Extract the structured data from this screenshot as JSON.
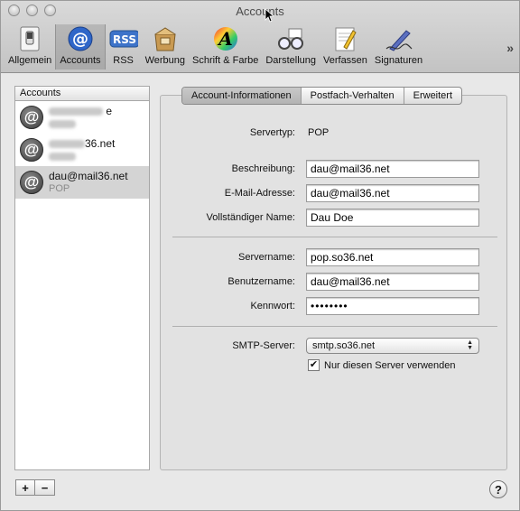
{
  "window": {
    "title": "Accounts"
  },
  "toolbar": {
    "items": [
      {
        "label": "Allgemein",
        "icon": "switch-icon"
      },
      {
        "label": "Accounts",
        "icon": "at-sign-icon"
      },
      {
        "label": "RSS",
        "icon": "rss-icon"
      },
      {
        "label": "Werbung",
        "icon": "junk-mail-icon"
      },
      {
        "label": "Schrift & Farbe",
        "icon": "font-color-icon"
      },
      {
        "label": "Darstellung",
        "icon": "viewing-glasses-icon"
      },
      {
        "label": "Verfassen",
        "icon": "compose-pencil-icon"
      },
      {
        "label": "Signaturen",
        "icon": "signature-pen-icon"
      }
    ],
    "overflow": "»"
  },
  "sidebar": {
    "header": "Accounts",
    "accounts": [
      {
        "name": "e",
        "sub": ""
      },
      {
        "name": "36.net",
        "sub": ""
      },
      {
        "name": "dau@mail36.net",
        "sub": "POP"
      }
    ],
    "add_label": "+",
    "remove_label": "−"
  },
  "tabs": [
    "Account-Informationen",
    "Postfach-Verhalten",
    "Erweitert"
  ],
  "form": {
    "servertyp_label": "Servertyp:",
    "servertyp_value": "POP",
    "beschreibung_label": "Beschreibung:",
    "beschreibung_value": "dau@mail36.net",
    "email_label": "E-Mail-Adresse:",
    "email_value": "dau@mail36.net",
    "name_label": "Vollständiger Name:",
    "name_value": "Dau Doe",
    "servername_label": "Servername:",
    "servername_value": "pop.so36.net",
    "benutzername_label": "Benutzername:",
    "benutzername_value": "dau@mail36.net",
    "kennwort_label": "Kennwort:",
    "kennwort_value": "••••••••",
    "smtp_label": "SMTP-Server:",
    "smtp_value": "smtp.so36.net",
    "checkbox_label": "Nur diesen Server verwenden",
    "checkbox_checked": true
  },
  "help_label": "?"
}
